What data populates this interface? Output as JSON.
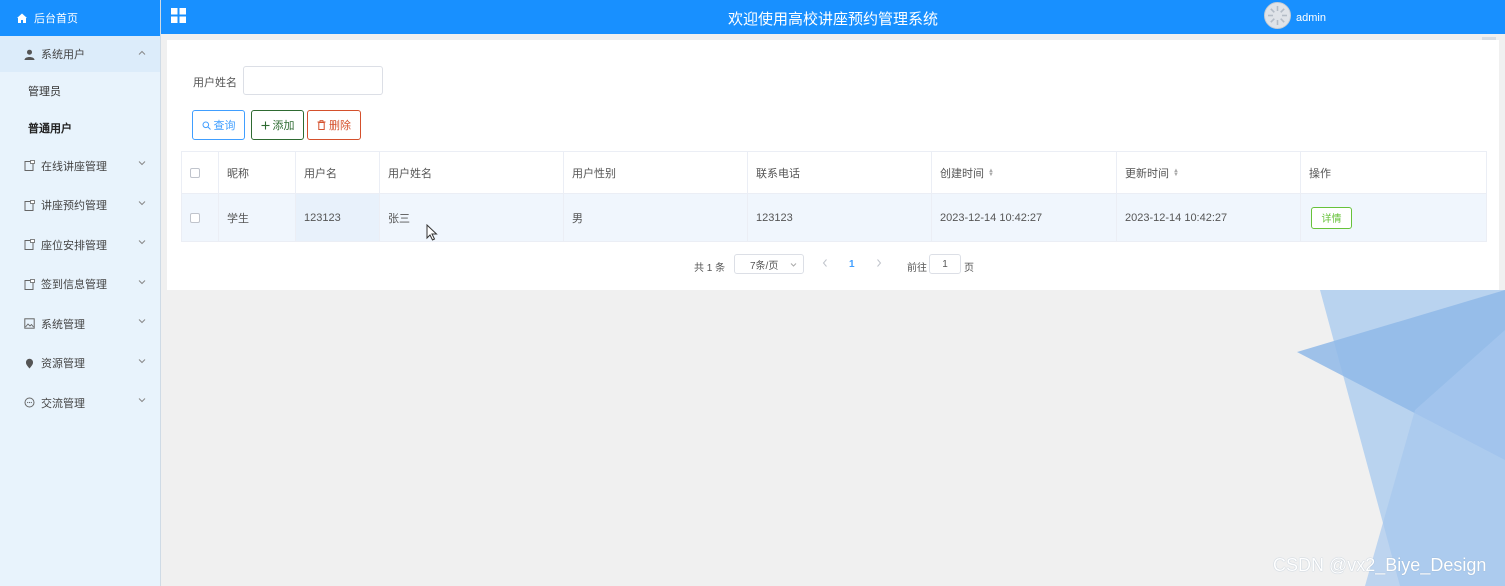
{
  "app": {
    "title": "欢迎使用高校讲座预约管理系统",
    "username": "admin",
    "accent_color": "#1890ff"
  },
  "sidebar": {
    "home": {
      "label": "后台首页",
      "icon": "home-icon"
    },
    "groups": [
      {
        "label": "系统用户",
        "icon": "user-icon",
        "expanded": true,
        "children": [
          {
            "label": "管理员",
            "active": false
          },
          {
            "label": "普通用户",
            "active": true
          }
        ]
      },
      {
        "label": "在线讲座管理",
        "icon": "clipboard-icon",
        "expanded": false
      },
      {
        "label": "讲座预约管理",
        "icon": "clipboard-icon",
        "expanded": false
      },
      {
        "label": "座位安排管理",
        "icon": "clipboard-icon",
        "expanded": false
      },
      {
        "label": "签到信息管理",
        "icon": "clipboard-icon",
        "expanded": false
      },
      {
        "label": "系统管理",
        "icon": "picture-icon",
        "expanded": false
      },
      {
        "label": "资源管理",
        "icon": "location-icon",
        "expanded": false
      },
      {
        "label": "交流管理",
        "icon": "chat-icon",
        "expanded": false
      }
    ]
  },
  "filter": {
    "label": "用户姓名",
    "value": ""
  },
  "buttons": {
    "search": "查询",
    "add": "添加",
    "delete": "删除"
  },
  "table": {
    "columns": [
      "昵称",
      "用户名",
      "用户姓名",
      "用户性别",
      "联系电话",
      "创建时间",
      "更新时间",
      "操作"
    ],
    "rows": [
      {
        "nickname": "学生",
        "username": "123123",
        "realname": "张三",
        "gender": "男",
        "phone": "123123",
        "created": "2023-12-14 10:42:27",
        "updated": "2023-12-14 10:42:27",
        "action": "详情"
      }
    ]
  },
  "pagination": {
    "total": "共 1 条",
    "page_size": "7条/页",
    "current_page": "1",
    "goto_label": "前往",
    "goto_value": "1",
    "page_suffix": "页"
  },
  "watermark": "CSDN @vx2_Biye_Design"
}
